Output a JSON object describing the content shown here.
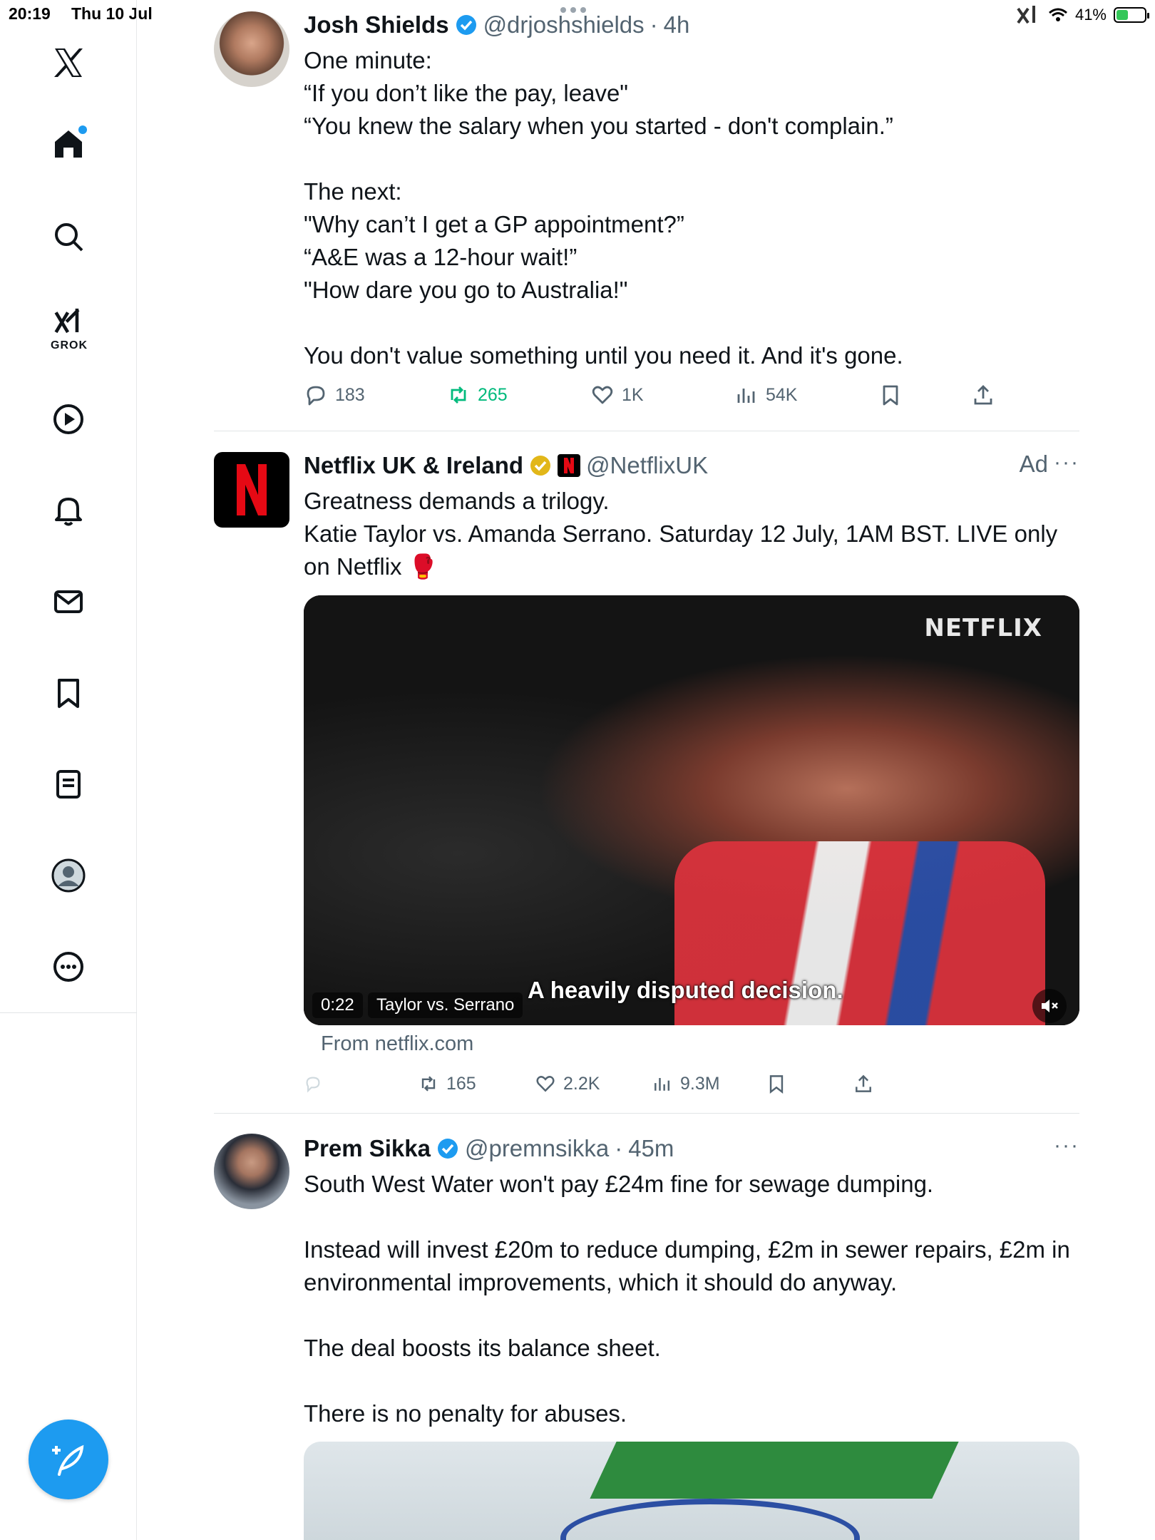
{
  "status_bar": {
    "time": "20:19",
    "date": "Thu 10 Jul",
    "battery": "41%"
  },
  "sidebar": {
    "items": [
      {
        "name": "home",
        "icon": "home-icon"
      },
      {
        "name": "explore",
        "icon": "search-icon"
      },
      {
        "name": "grok",
        "icon": "grok-icon",
        "label": "GROK"
      },
      {
        "name": "video",
        "icon": "play-icon"
      },
      {
        "name": "notifications",
        "icon": "bell-icon"
      },
      {
        "name": "messages",
        "icon": "mail-icon"
      },
      {
        "name": "bookmarks",
        "icon": "bookmark-icon"
      },
      {
        "name": "lists",
        "icon": "list-icon"
      },
      {
        "name": "profile",
        "icon": "profile-icon"
      },
      {
        "name": "more",
        "icon": "more-circle-icon"
      }
    ],
    "compose": "compose-icon",
    "accent": "#1d9bf0"
  },
  "posts": [
    {
      "name": "Josh Shields",
      "handle": "@drjoshshields",
      "time": "4h",
      "lines": [
        "One minute:",
        "“If you don’t like the pay, leave\"",
        "“You knew the salary when you started - don't complain.”",
        "",
        "The next:",
        "\"Why can’t I get a GP appointment?”",
        "“A&E was a 12-hour wait!”",
        "\"How dare you go to Australia!\"",
        "",
        "You don't value something until you need it. And it's gone."
      ],
      "replies": "183",
      "reposts": "265",
      "likes": "1K",
      "views": "54K"
    },
    {
      "name": "Netflix UK & Ireland",
      "handle": "@NetflixUK",
      "ad": "Ad",
      "lines": [
        "Greatness demands a trilogy.",
        "Katie Taylor vs. Amanda Serrano. Saturday 12 July, 1AM BST. LIVE only on Netflix 🥊"
      ],
      "video": {
        "watermark": "NETFLIX",
        "caption": "A heavily disputed decision.",
        "duration": "0:22",
        "title": "Taylor vs. Serrano"
      },
      "from": "From netflix.com",
      "reposts": "165",
      "likes": "2.2K",
      "views": "9.3M"
    },
    {
      "name": "Prem Sikka",
      "handle": "@premnsikka",
      "time": "45m",
      "lines": [
        "South West Water won't pay £24m fine for sewage dumping.",
        "",
        "Instead will invest £20m to reduce dumping, £2m in sewer repairs, £2m in environmental improvements, which it should do anyway.",
        "",
        "The deal boosts its balance sheet.",
        "",
        "There is no penalty for abuses."
      ]
    }
  ]
}
